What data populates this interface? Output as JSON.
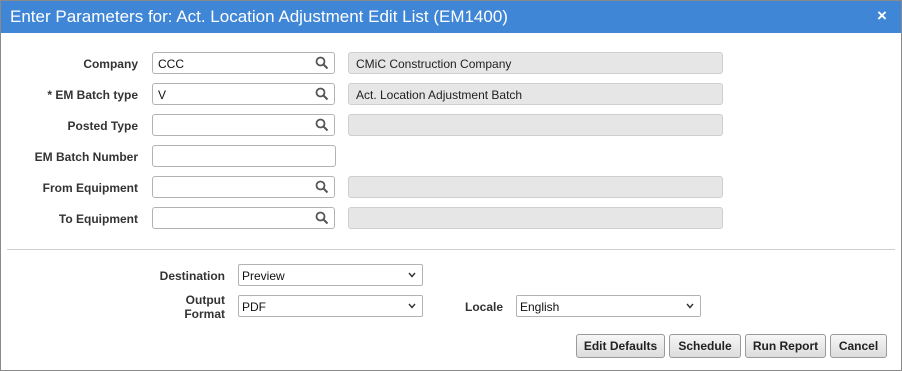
{
  "dialog": {
    "title": "Enter Parameters for: Act. Location Adjustment Edit List (EM1400)",
    "close_glyph": "×"
  },
  "params": {
    "company": {
      "label": "Company",
      "value": "CCC",
      "description": "CMiC Construction Company"
    },
    "em_batch_type": {
      "label": "* EM Batch type",
      "value": "V",
      "description": "Act. Location Adjustment Batch"
    },
    "posted_type": {
      "label": "Posted Type",
      "value": "",
      "description": ""
    },
    "em_batch_number": {
      "label": "EM Batch Number",
      "value": ""
    },
    "from_equipment": {
      "label": "From Equipment",
      "value": "",
      "description": ""
    },
    "to_equipment": {
      "label": "To Equipment",
      "value": "",
      "description": ""
    }
  },
  "output": {
    "destination": {
      "label": "Destination",
      "value": "Preview"
    },
    "output_format": {
      "label_line1": "Output",
      "label_line2": "Format",
      "value": "PDF"
    },
    "locale": {
      "label": "Locale",
      "value": "English"
    }
  },
  "buttons": {
    "edit_defaults": "Edit Defaults",
    "schedule": "Schedule",
    "run_report": "Run Report",
    "cancel": "Cancel"
  },
  "icons": {
    "lookup": "search-icon",
    "dropdown": "chevron-down-icon"
  },
  "colors": {
    "titlebar": "#3f86d6",
    "readonly_field": "#e6e6e6"
  }
}
